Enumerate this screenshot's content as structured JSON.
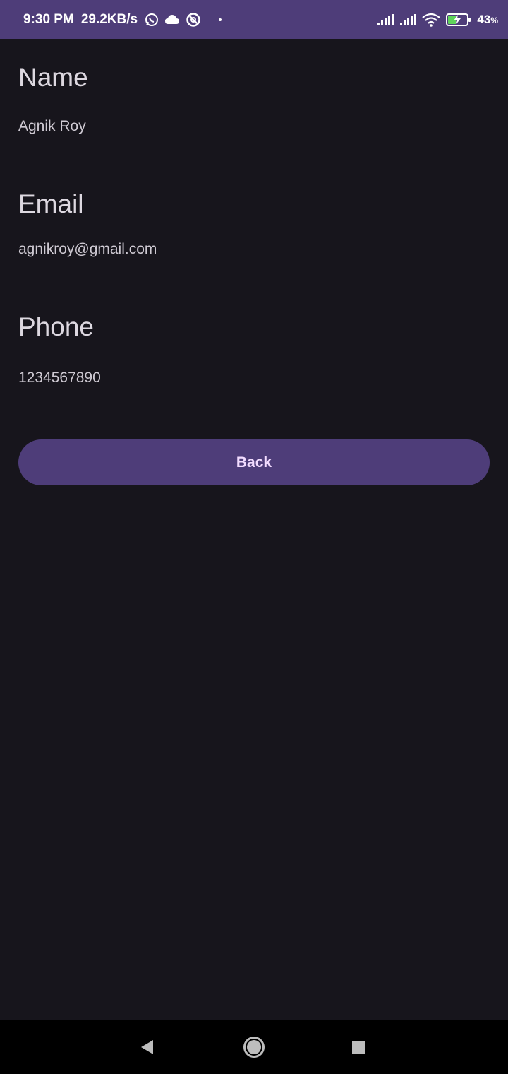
{
  "status_bar": {
    "time": "9:30 PM",
    "network_speed": "29.2KB/s",
    "battery_percent": "43",
    "battery_unit": "%",
    "icons": [
      "whatsapp-icon",
      "cloud-icon",
      "vpn-icon",
      "dot-icon",
      "signal-icon",
      "signal-icon",
      "wifi-icon",
      "battery-charging-icon"
    ],
    "background_color": "#4e3d79"
  },
  "profile": {
    "name_label": "Name",
    "name_value": "Agnik Roy",
    "email_label": "Email",
    "email_value": "agnikroy@gmail.com",
    "phone_label": "Phone",
    "phone_value": "1234567890"
  },
  "actions": {
    "back_label": "Back",
    "accent_color": "#4e3d79"
  },
  "navigation": {
    "buttons": [
      "back-triangle-icon",
      "home-circle-icon",
      "recents-square-icon"
    ]
  }
}
